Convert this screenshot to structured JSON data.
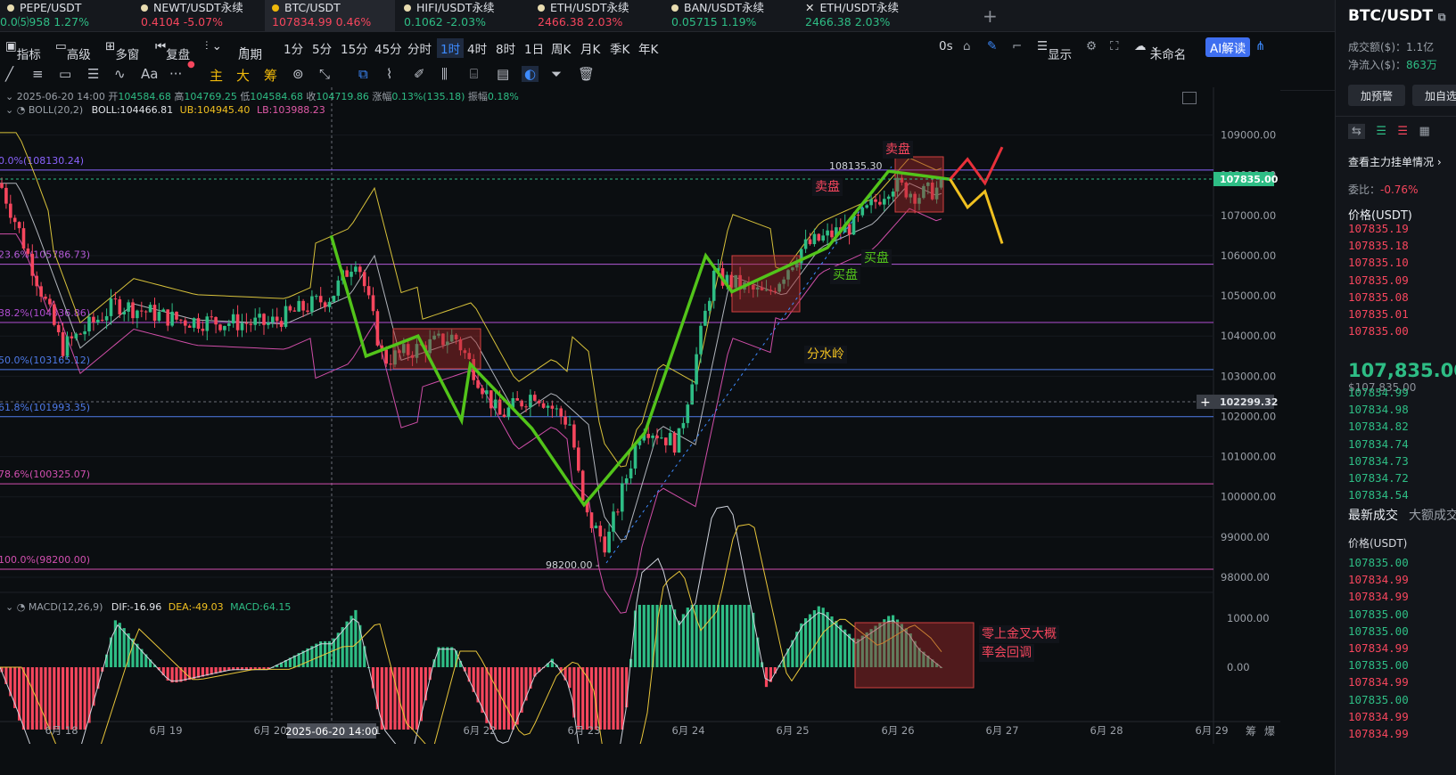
{
  "tabs": [
    {
      "name": "PEPE/USDT",
      "price": "0.0⑸958",
      "change": "1.27%",
      "dir": "up",
      "icon": "coin-icon"
    },
    {
      "name": "NEWT/USDT永续",
      "price": "0.4104",
      "change": "-5.07%",
      "dir": "dn",
      "icon": "coin-icon"
    },
    {
      "name": "BTC/USDT",
      "price": "107834.99",
      "change": "0.46%",
      "dir": "dn",
      "icon": "bitcoin-icon"
    },
    {
      "name": "HIFI/USDT永续",
      "price": "0.1062",
      "change": "-2.03%",
      "dir": "up",
      "icon": "coin-icon"
    },
    {
      "name": "ETH/USDT永续",
      "price": "2466.38",
      "change": "2.03%",
      "dir": "dn",
      "icon": "coin-icon"
    },
    {
      "name": "BAN/USDT永续",
      "price": "0.05715",
      "change": "1.19%",
      "dir": "up",
      "icon": "coin-icon"
    },
    {
      "name": "ETH/USDT永续",
      "price": "2466.38",
      "change": "2.03%",
      "dir": "up",
      "icon": "close-icon"
    }
  ],
  "toolbar": {
    "indicator": "指标",
    "advanced": "高级",
    "multi": "多窗",
    "replay": "复盘",
    "period": "周期",
    "intervals": [
      "1分",
      "5分",
      "15分",
      "45分",
      "分时",
      "1时",
      "4时",
      "8时",
      "1日",
      "周K",
      "月K",
      "季K",
      "年K"
    ],
    "active_interval": "1时",
    "time": "0s",
    "display": "显示",
    "unnamed": "未命名",
    "ai": "AI解读"
  },
  "drawtools": {
    "main": "主",
    "big": "大",
    "chips": "筹",
    "text": "Aa",
    "more": "···"
  },
  "ohlc": {
    "date": "2025-06-20 14:00",
    "open_label": "开",
    "open": "104584.68",
    "high_label": "高",
    "high": "104769.25",
    "low_label": "低",
    "low": "104584.68",
    "close_label": "收",
    "close": "104719.86",
    "amp_label": "涨幅",
    "amp": "0.13%(135.18)",
    "range_label": "振幅",
    "range": "0.18%"
  },
  "boll": {
    "label": "BOLL(20,2)",
    "boll": "BOLL:104466.81",
    "ub": "UB:104945.40",
    "lb": "LB:103988.23"
  },
  "macd": {
    "label": "MACD(12,26,9)",
    "dif": "DIF:-16.96",
    "dea": "DEA:-49.03",
    "macd": "MACD:64.15"
  },
  "fib": [
    {
      "text": "0.0%(108130.24)",
      "color": "#8b63ff",
      "price": 108130.24
    },
    {
      "text": "23.6%(105786.73)",
      "color": "#b45ad7",
      "price": 105786.73
    },
    {
      "text": "38.2%(104336.86)",
      "color": "#b04dd1",
      "price": 104336.86
    },
    {
      "text": "50.0%(103165.12)",
      "color": "#4d79e6",
      "price": 103165.12
    },
    {
      "text": "61.8%(101993.35)",
      "color": "#4d79e6",
      "price": 101993.35
    },
    {
      "text": "78.6%(100325.07)",
      "color": "#d24fb0",
      "price": 100325.07
    },
    {
      "text": "100.0%(98200.00)",
      "color": "#d24fb0",
      "price": 98200.0
    }
  ],
  "y_ticks": [
    "109000.00",
    "108000.00",
    "107000.00",
    "106000.00",
    "105000.00",
    "104000.00",
    "103000.00",
    "102000.00",
    "101000.00",
    "100000.00",
    "99000.00",
    "98000.00"
  ],
  "price_current": "107835.00",
  "price_cursor": "102299.32",
  "high_mark": "108135.30",
  "low_mark": "98200.00",
  "macd_ticks": [
    "1000.00",
    "0.00"
  ],
  "x_ticks": [
    "6月 18",
    "6月 19",
    "6月 20",
    "21",
    "6月 22",
    "6月 23",
    "6月 24",
    "6月 25",
    "6月 26",
    "6月 27",
    "6月 28",
    "6月 29"
  ],
  "x_cursor": "2025-06-20 14:00",
  "corner": [
    "筹",
    "爆"
  ],
  "annotations": {
    "sell1": "卖盘",
    "sell2": "卖盘",
    "buy1": "买盘",
    "buy2": "买盘",
    "watershed": "分水岭",
    "macd_note": "零上金叉大概率会回调"
  },
  "chart_data": {
    "type": "candlestick",
    "y_range": [
      97800,
      109300
    ],
    "zigzag_green": [
      [
        "06-20 14",
        106500
      ],
      [
        "06-20 22",
        103500
      ],
      [
        "06-21 10",
        104000
      ],
      [
        "06-21 20",
        101900
      ],
      [
        "06-21 22",
        103300
      ],
      [
        "06-22 12",
        101700
      ],
      [
        "06-23 00",
        99800
      ],
      [
        "06-23 14",
        101600
      ],
      [
        "06-24 04",
        106000
      ],
      [
        "06-24 10",
        105100
      ],
      [
        "06-25 08",
        106200
      ],
      [
        "06-25 22",
        108100
      ],
      [
        "06-26 12",
        107900
      ]
    ],
    "projection_red": [
      [
        "06-26 12",
        107900
      ],
      [
        "06-26 16",
        108400
      ],
      [
        "06-26 20",
        107800
      ],
      [
        "06-27 00",
        108700
      ]
    ],
    "projection_yellow": [
      [
        "06-26 12",
        107900
      ],
      [
        "06-26 16",
        107200
      ],
      [
        "06-26 20",
        107600
      ],
      [
        "06-27 00",
        106300
      ]
    ]
  },
  "right": {
    "pair": "BTC/USDT",
    "vol_label": "成交额($)：",
    "vol": "1.1亿",
    "inflow_label": "净流入($)：",
    "inflow": "863万",
    "alert": "加预警",
    "fav": "加自选",
    "depth": "查看主力挂单情况",
    "ratio_label": "委比：",
    "ratio": "-0.76%",
    "price_head": "价格(USDT)",
    "asks": [
      "107835.19",
      "107835.18",
      "107835.10",
      "107835.09",
      "107835.08",
      "107835.01",
      "107835.00"
    ],
    "last": "107,835.00",
    "last_usd": "$107,835.00",
    "bids": [
      "107834.99",
      "107834.98",
      "107834.82",
      "107834.74",
      "107834.73",
      "107834.72",
      "107834.54"
    ],
    "trades_tab": "最新成交",
    "big_tab": "大额成交",
    "trades_head": "价格(USDT)",
    "trades": [
      {
        "p": "107835.00",
        "d": "up"
      },
      {
        "p": "107834.99",
        "d": "dn"
      },
      {
        "p": "107834.99",
        "d": "dn"
      },
      {
        "p": "107835.00",
        "d": "up"
      },
      {
        "p": "107835.00",
        "d": "up"
      },
      {
        "p": "107834.99",
        "d": "dn"
      },
      {
        "p": "107835.00",
        "d": "up"
      },
      {
        "p": "107834.99",
        "d": "dn"
      },
      {
        "p": "107835.00",
        "d": "up"
      },
      {
        "p": "107834.99",
        "d": "dn"
      },
      {
        "p": "107834.99",
        "d": "dn"
      }
    ]
  },
  "colors": {
    "up": "#2ebd85",
    "down": "#f6465d",
    "bg": "#0b0e11",
    "green_line": "#52c41a"
  }
}
